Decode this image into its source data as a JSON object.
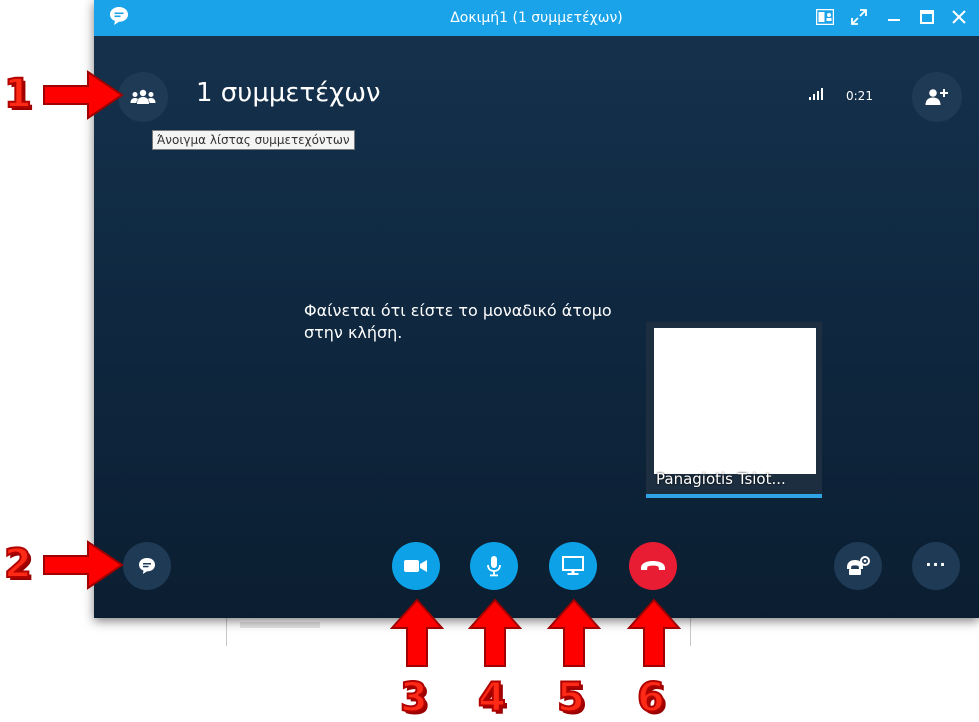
{
  "window": {
    "title": "Δοκιμή1 (1 συμμετέχων)"
  },
  "header": {
    "participants_title": "1 συμμετέχων",
    "tooltip": "Άνοιγμα λίστας συμμετεχόντων",
    "call_timer": "0:21"
  },
  "main": {
    "alone_message": "Φαίνεται ότι είστε το μοναδικό άτομο στην κλήση."
  },
  "self_preview": {
    "name": "Panagiotis Tsiot..."
  },
  "annotations": {
    "n1": "1",
    "n2": "2",
    "n3": "3",
    "n4": "4",
    "n5": "5",
    "n6": "6"
  },
  "colors": {
    "titlebar": "#1aa3e8",
    "accent_blue": "#0da2e7",
    "hangup_red": "#e81c32",
    "annotation_red": "#ff2a16"
  },
  "icons": {
    "app": "chat-bubble-icon",
    "participants": "people-group-icon",
    "add_person": "add-person-icon",
    "signal": "signal-bars-icon",
    "chat": "chat-bubble-icon",
    "video": "video-camera-icon",
    "mic": "microphone-icon",
    "share": "monitor-icon",
    "hangup": "phone-hangup-icon",
    "call_settings": "phone-gear-icon",
    "more": "ellipsis-icon"
  }
}
